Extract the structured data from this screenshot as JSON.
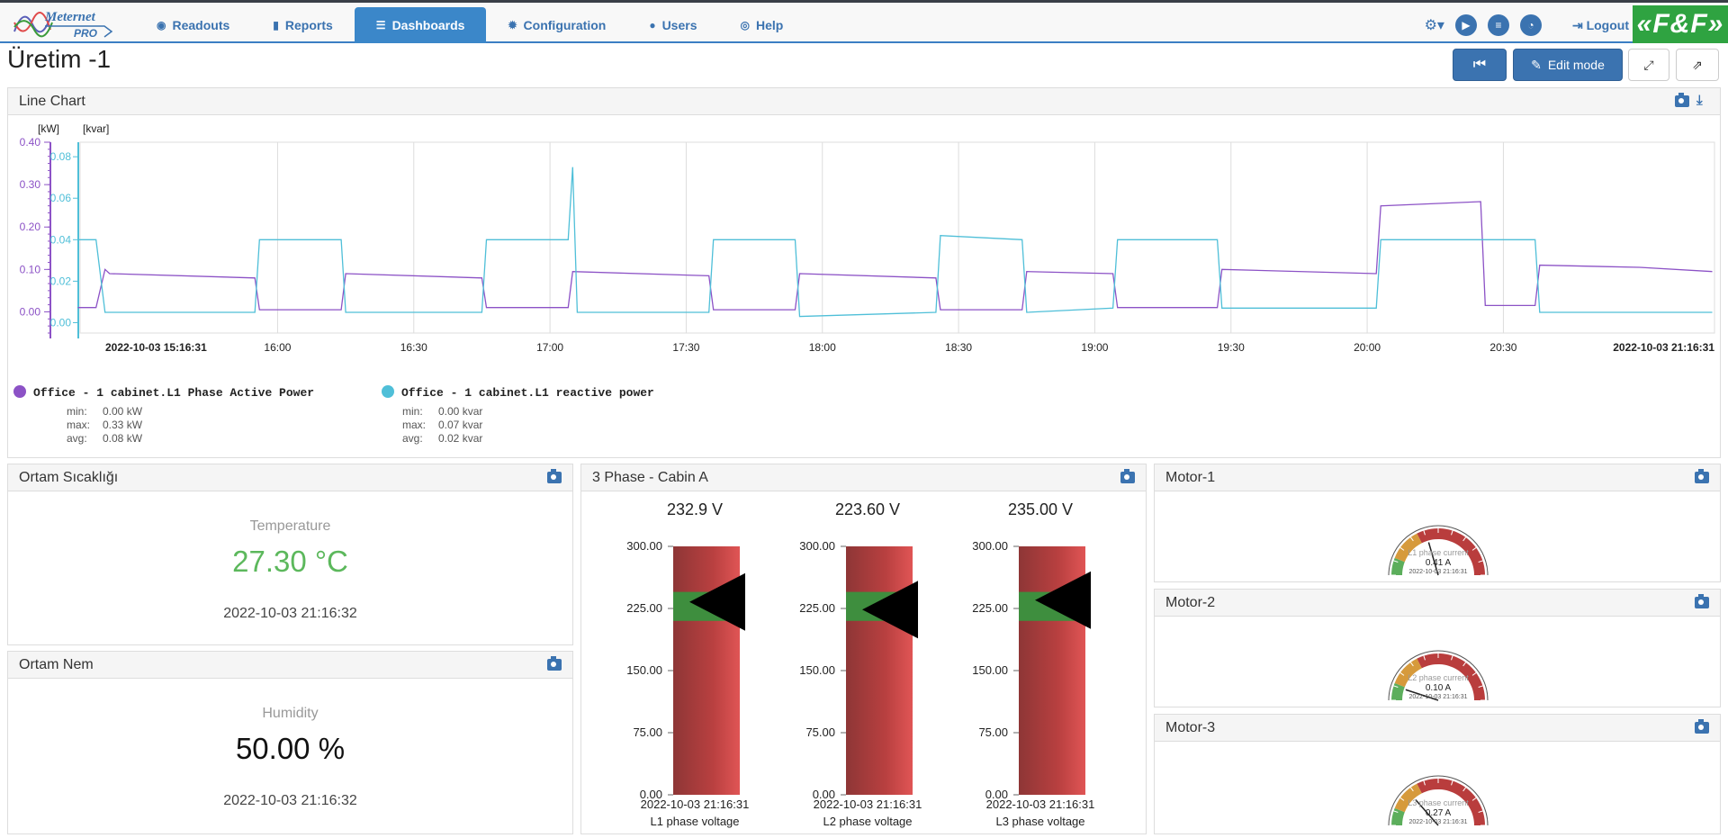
{
  "nav": {
    "logo_name": "Meternet",
    "logo_sub": "PRO",
    "items": [
      {
        "label": "Readouts",
        "icon": "eye-icon",
        "glyph": "◉"
      },
      {
        "label": "Reports",
        "icon": "bar-chart-icon",
        "glyph": "▮"
      },
      {
        "label": "Dashboards",
        "icon": "list-icon",
        "glyph": "☰"
      },
      {
        "label": "Configuration",
        "icon": "gear-icon",
        "glyph": "✹"
      },
      {
        "label": "Users",
        "icon": "user-icon",
        "glyph": "●"
      },
      {
        "label": "Help",
        "icon": "lifebuoy-icon",
        "glyph": "◎"
      }
    ],
    "active": "Dashboards",
    "logout": "Logout",
    "brand": "«F&F»"
  },
  "page": {
    "title": "Üretim -1",
    "edit_mode": "Edit mode"
  },
  "line_chart": {
    "title": "Line Chart",
    "unit_left": "[kW]",
    "unit_right": "[kvar]",
    "series": [
      {
        "name": "Office - 1 cabinet.L1 Phase Active Power",
        "color": "#8c52c6",
        "min": "0.00 kW",
        "max": "0.33 kW",
        "avg": "0.08 kW"
      },
      {
        "name": "Office - 1 cabinet.L1 reactive power",
        "color": "#4fbfd8",
        "min": "0.00 kvar",
        "max": "0.07 kvar",
        "avg": "0.02 kvar"
      }
    ],
    "stat_labels": {
      "min": "min:",
      "max": "max:",
      "avg": "avg:"
    }
  },
  "chart_data": {
    "type": "line",
    "x_start": "2022-10-03 15:16:31",
    "x_end": "2022-10-03 21:16:31",
    "x_ticks": [
      "16:00",
      "16:30",
      "17:00",
      "17:30",
      "18:00",
      "18:30",
      "19:00",
      "19:30",
      "20:00",
      "20:30"
    ],
    "y_left": {
      "label": "[kW]",
      "ticks": [
        "0.00",
        "0.10",
        "0.20",
        "0.30",
        "0.40"
      ],
      "range": [
        -0.05,
        0.4
      ]
    },
    "y_right": {
      "label": "[kvar]",
      "ticks": [
        "0.00",
        "0.02",
        "0.04",
        "0.06",
        "0.08"
      ],
      "range": [
        -0.005,
        0.087
      ]
    },
    "series": [
      {
        "name": "Office - 1 cabinet.L1 Phase Active Power",
        "axis": "left",
        "points": [
          [
            "15:16",
            0.01
          ],
          [
            "15:20",
            0.01
          ],
          [
            "15:22",
            0.1
          ],
          [
            "15:23",
            0.09
          ],
          [
            "15:55",
            0.08
          ],
          [
            "15:56",
            0.005
          ],
          [
            "16:14",
            0.005
          ],
          [
            "16:15",
            0.09
          ],
          [
            "16:45",
            0.08
          ],
          [
            "16:46",
            0.01
          ],
          [
            "17:04",
            0.01
          ],
          [
            "17:05",
            0.095
          ],
          [
            "17:35",
            0.085
          ],
          [
            "17:36",
            0.005
          ],
          [
            "17:54",
            0.005
          ],
          [
            "17:55",
            0.09
          ],
          [
            "18:25",
            0.08
          ],
          [
            "18:26",
            0.005
          ],
          [
            "18:44",
            0.005
          ],
          [
            "18:45",
            0.095
          ],
          [
            "19:04",
            0.09
          ],
          [
            "19:05",
            0.01
          ],
          [
            "19:27",
            0.01
          ],
          [
            "19:28",
            0.1
          ],
          [
            "20:02",
            0.09
          ],
          [
            "20:03",
            0.25
          ],
          [
            "20:25",
            0.26
          ],
          [
            "20:26",
            0.015
          ],
          [
            "20:37",
            0.015
          ],
          [
            "20:38",
            0.11
          ],
          [
            "21:00",
            0.105
          ],
          [
            "21:16",
            0.095
          ]
        ]
      },
      {
        "name": "Office - 1 cabinet.L1 reactive power",
        "axis": "right",
        "points": [
          [
            "15:16",
            0.04
          ],
          [
            "15:20",
            0.04
          ],
          [
            "15:22",
            0.005
          ],
          [
            "15:55",
            0.005
          ],
          [
            "15:56",
            0.04
          ],
          [
            "16:14",
            0.04
          ],
          [
            "16:15",
            0.005
          ],
          [
            "16:45",
            0.005
          ],
          [
            "16:46",
            0.04
          ],
          [
            "17:04",
            0.04
          ],
          [
            "17:05",
            0.075
          ],
          [
            "17:06",
            0.005
          ],
          [
            "17:35",
            0.005
          ],
          [
            "17:36",
            0.04
          ],
          [
            "17:54",
            0.04
          ],
          [
            "17:55",
            0.003
          ],
          [
            "18:25",
            0.005
          ],
          [
            "18:26",
            0.042
          ],
          [
            "18:44",
            0.04
          ],
          [
            "18:45",
            0.005
          ],
          [
            "19:04",
            0.007
          ],
          [
            "19:05",
            0.04
          ],
          [
            "19:27",
            0.04
          ],
          [
            "19:28",
            0.007
          ],
          [
            "20:02",
            0.007
          ],
          [
            "20:03",
            0.04
          ],
          [
            "20:25",
            0.04
          ],
          [
            "20:26",
            0.04
          ],
          [
            "20:37",
            0.04
          ],
          [
            "20:38",
            0.005
          ],
          [
            "21:16",
            0.005
          ]
        ]
      }
    ]
  },
  "temp": {
    "title": "Ortam Sıcaklığı",
    "label": "Temperature",
    "value": "27.30 °C",
    "time": "2022-10-03 21:16:32",
    "color": "#5cb85c"
  },
  "hum": {
    "title": "Ortam Nem",
    "label": "Humidity",
    "value": "50.00 %",
    "time": "2022-10-03 21:16:32",
    "color": "#111111"
  },
  "phase": {
    "title": "3 Phase - Cabin A",
    "ticks": [
      "300.00",
      "225.00",
      "150.00",
      "75.00",
      "0.00"
    ],
    "range": [
      0,
      300
    ],
    "band": [
      210,
      245
    ],
    "meters": [
      {
        "value": 232.9,
        "value_text": "232.9 V",
        "time": "2022-10-03 21:16:31",
        "label": "L1 phase voltage"
      },
      {
        "value": 223.6,
        "value_text": "223.60 V",
        "time": "2022-10-03 21:16:31",
        "label": "L2 phase voltage"
      },
      {
        "value": 235.0,
        "value_text": "235.00 V",
        "time": "2022-10-03 21:16:31",
        "label": "L3 phase voltage"
      }
    ]
  },
  "motors": [
    {
      "title": "Motor-1",
      "label": "L1 phase current",
      "value": 0.41,
      "value_text": "0.41 A",
      "time": "2022-10-03 21:16:31"
    },
    {
      "title": "Motor-2",
      "label": "L2 phase current",
      "value": 0.1,
      "value_text": "0.10 A",
      "time": "2022-10-03 21:16:31"
    },
    {
      "title": "Motor-3",
      "label": "L3 phase current",
      "value": 0.27,
      "value_text": "0.27 A",
      "time": "2022-10-03 21:16:31"
    }
  ],
  "gauge_max": 1.0
}
